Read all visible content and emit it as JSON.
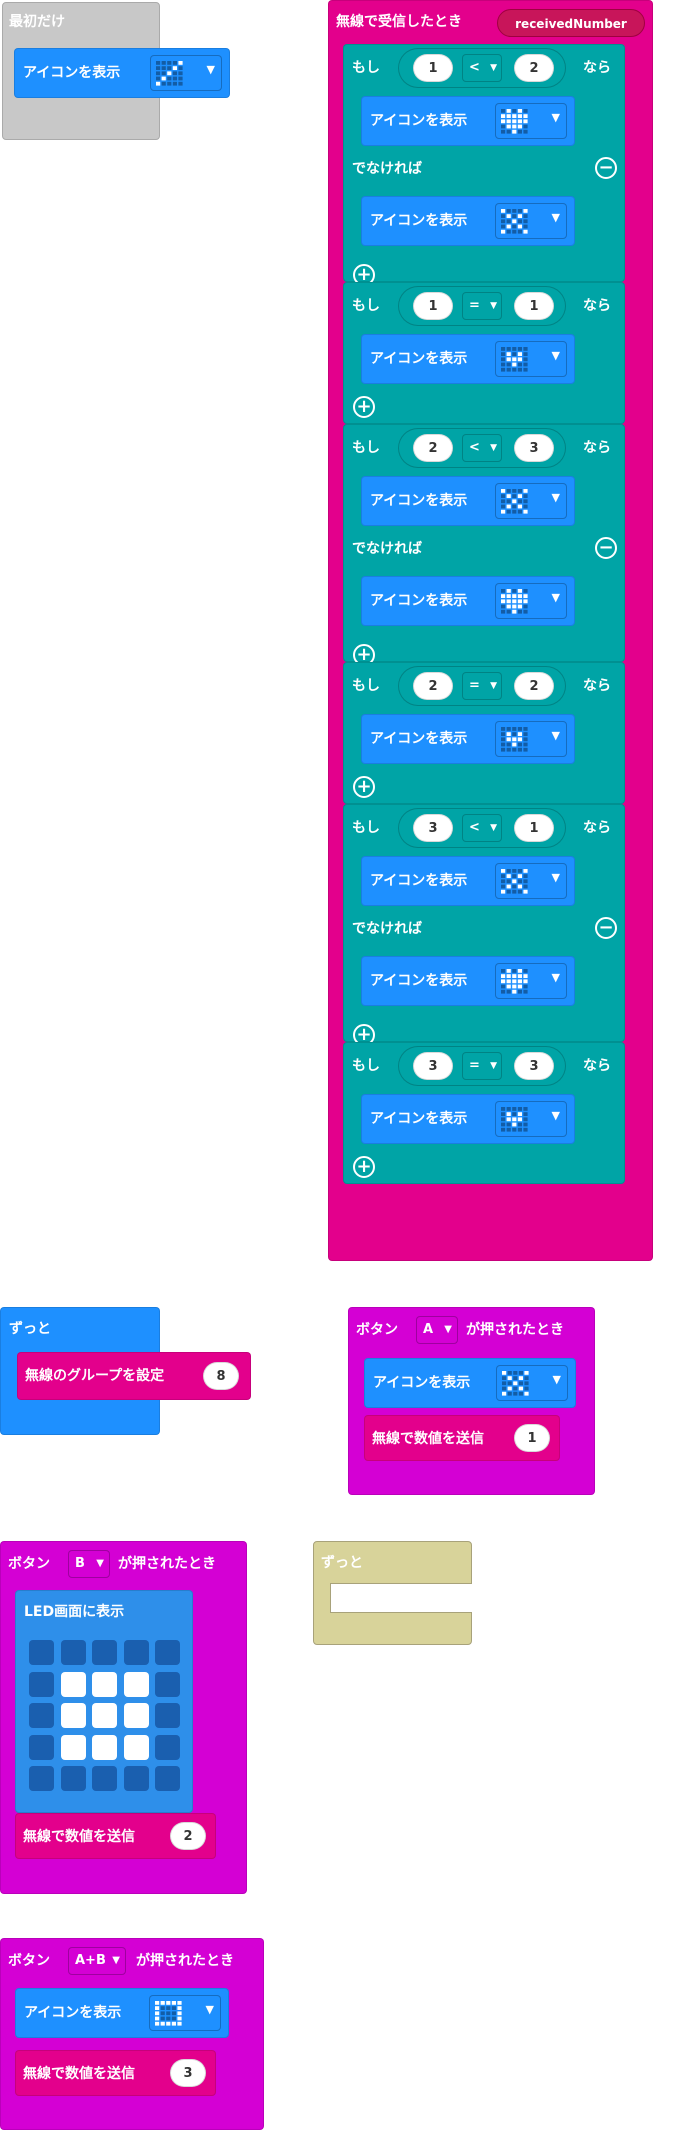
{
  "icons": {
    "arrow": "dropdown-arrow-icon",
    "plus": "plus-icon",
    "minus": "minus-icon"
  },
  "colors": {
    "basic": "#1E90FF",
    "logic": "#00A4A6",
    "radio": "#E3008C",
    "input": "#D400D4",
    "led": "#2E8FEA",
    "disabled": "#C8C8C8"
  },
  "on_start": {
    "label": "最初だけ",
    "show_icon": "アイコンを表示",
    "icon": "diagonal"
  },
  "radio_received": {
    "label": "無線で受信したとき",
    "param": "receivedNumber",
    "if_label": "もし",
    "then_label": "なら",
    "else_label": "でなければ",
    "show_icon": "アイコンを表示",
    "conditions": [
      {
        "left": "1",
        "op": "<",
        "right": "2",
        "then_icon": "heart",
        "else_icon": "x"
      },
      {
        "left": "1",
        "op": "=",
        "right": "1",
        "then_icon": "small_heart"
      },
      {
        "left": "2",
        "op": "<",
        "right": "3",
        "then_icon": "x",
        "else_icon": "heart"
      },
      {
        "left": "2",
        "op": "=",
        "right": "2",
        "then_icon": "small_heart"
      },
      {
        "left": "3",
        "op": "<",
        "right": "1",
        "then_icon": "x",
        "else_icon": "heart"
      },
      {
        "left": "3",
        "op": "=",
        "right": "3",
        "then_icon": "small_heart"
      }
    ]
  },
  "forever1": {
    "label": "ずっと",
    "set_group": "無線のグループを設定",
    "group": "8"
  },
  "button_a": {
    "prefix": "ボタン",
    "button": "A",
    "suffix": "が押されたとき",
    "show_icon": "アイコンを表示",
    "icon": "x",
    "send": "無線で数値を送信",
    "value": "1"
  },
  "button_b": {
    "prefix": "ボタン",
    "button": "B",
    "suffix": "が押されたとき",
    "led_label": "LED画面に表示",
    "send": "無線で数値を送信",
    "value": "2",
    "leds": [
      [
        0,
        0,
        0,
        0,
        0
      ],
      [
        0,
        1,
        1,
        1,
        0
      ],
      [
        0,
        1,
        1,
        1,
        0
      ],
      [
        0,
        1,
        1,
        1,
        0
      ],
      [
        0,
        0,
        0,
        0,
        0
      ]
    ]
  },
  "forever2": {
    "label": "ずっと"
  },
  "button_ab": {
    "prefix": "ボタン",
    "button": "A+B",
    "suffix": "が押されたとき",
    "show_icon": "アイコンを表示",
    "icon": "square",
    "send": "無線で数値を送信",
    "value": "3"
  }
}
